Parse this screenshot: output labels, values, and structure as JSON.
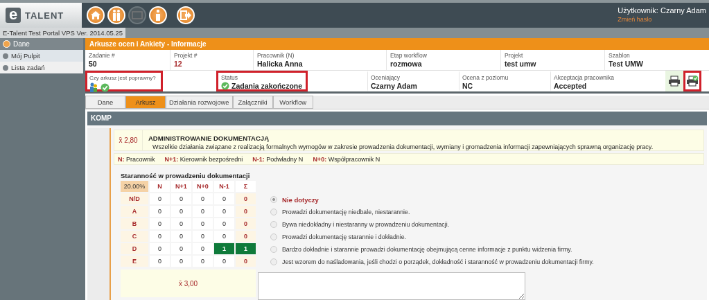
{
  "header": {
    "logo_mark": "e",
    "logo_text": "TALENT",
    "user": "Użytkownik: Czarny Adam",
    "change_password": "Zmień hasło",
    "toolbar": [
      {
        "kind": "home",
        "disabled": false
      },
      {
        "kind": "people",
        "disabled": false
      },
      {
        "kind": "blank",
        "disabled": true
      },
      {
        "kind": "info",
        "disabled": false
      },
      {
        "kind": "exit",
        "disabled": false
      }
    ]
  },
  "version": "E-Talent Test Portal VPS Ver. 2014.05.25",
  "sidebar": {
    "header": "Dane",
    "items": [
      {
        "label": "Mój Pulpit",
        "selected": true
      },
      {
        "label": "Lista zadań",
        "selected": false
      }
    ]
  },
  "page_title": "Arkusze ocen i Ankiety - Informacje",
  "info_row_1": [
    {
      "label": "Zadanie #",
      "value": "50",
      "kind": "text"
    },
    {
      "label": "Projekt #",
      "value": "12",
      "kind": "accent"
    },
    {
      "label": "Pracownik (N)",
      "value": "Halicka Anna",
      "kind": "text"
    },
    {
      "label": "Etap workflow",
      "value": "rozmowa",
      "kind": "text"
    },
    {
      "label": "Projekt",
      "value": "test umw",
      "kind": "text"
    },
    {
      "label": "Szablon",
      "value": "Test UMW",
      "kind": "text"
    }
  ],
  "info_row_2": [
    {
      "label": "Czy arkusz jest poprawny?",
      "kind": "validity",
      "highlighted": true
    },
    {
      "label": "Status",
      "value": "Zadania zakończone",
      "kind": "status",
      "highlighted": true
    },
    {
      "label": "Oceniający",
      "value": "Czarny Adam",
      "kind": "text",
      "highlighted": false
    },
    {
      "label": "Ocena z poziomu",
      "value": "NC",
      "kind": "text",
      "highlighted": false
    },
    {
      "label": "Akceptacja pracownika",
      "value": "Accepted",
      "kind": "text",
      "highlighted": false
    }
  ],
  "print_buttons": [
    {
      "kind": "print",
      "highlighted": false
    },
    {
      "kind": "print_checked",
      "highlighted": true
    }
  ],
  "tabs": [
    {
      "label": "Dane",
      "selected": false
    },
    {
      "label": "Arkusz",
      "selected": true
    },
    {
      "label": "Działania rozwojowe",
      "selected": false
    },
    {
      "label": "Załączniki",
      "selected": false
    },
    {
      "label": "Workflow",
      "selected": false
    }
  ],
  "section_title": "KOMP",
  "competency": {
    "score": "x̄ 2,80",
    "title": "ADMINISTROWANIE DOKUMENTACJĄ",
    "description": "Wszelkie działania związane z realizacją formalnych wymogów w zakresie prowadzenia dokumentacji, wymiany i gromadzenia informacji zapewniających sprawną organizację pracy."
  },
  "legend": [
    {
      "key": "N:",
      "label": "Pracownik"
    },
    {
      "key": "N+1:",
      "label": "Kierownik bezpośredni"
    },
    {
      "key": "N-1:",
      "label": "Podwładny N"
    },
    {
      "key": "N+0:",
      "label": "Współpracownik N"
    }
  ],
  "question": "Staranność w prowadzeniu dokumentacji",
  "matrix": {
    "weight": "20.00%",
    "columns": [
      "N",
      "N+1",
      "N+0",
      "N-1"
    ],
    "sum_header": "Σ",
    "rows": [
      {
        "label": "N/D",
        "cells": [
          {
            "text": "0",
            "selected": false
          },
          {
            "text": "0",
            "selected": false
          },
          {
            "text": "0",
            "selected": false
          },
          {
            "text": "0",
            "selected": false
          }
        ],
        "sum": {
          "text": "0",
          "selected": false
        }
      },
      {
        "label": "A",
        "cells": [
          {
            "text": "0",
            "selected": false
          },
          {
            "text": "0",
            "selected": false
          },
          {
            "text": "0",
            "selected": false
          },
          {
            "text": "0",
            "selected": false
          }
        ],
        "sum": {
          "text": "0",
          "selected": false
        }
      },
      {
        "label": "B",
        "cells": [
          {
            "text": "0",
            "selected": false
          },
          {
            "text": "0",
            "selected": false
          },
          {
            "text": "0",
            "selected": false
          },
          {
            "text": "0",
            "selected": false
          }
        ],
        "sum": {
          "text": "0",
          "selected": false
        }
      },
      {
        "label": "C",
        "cells": [
          {
            "text": "0",
            "selected": false
          },
          {
            "text": "0",
            "selected": false
          },
          {
            "text": "0",
            "selected": false
          },
          {
            "text": "0",
            "selected": false
          }
        ],
        "sum": {
          "text": "0",
          "selected": false
        }
      },
      {
        "label": "D",
        "cells": [
          {
            "text": "0",
            "selected": false
          },
          {
            "text": "0",
            "selected": false
          },
          {
            "text": "0",
            "selected": false
          },
          {
            "text": "1",
            "selected": true
          }
        ],
        "sum": {
          "text": "1",
          "selected": true
        }
      },
      {
        "label": "E",
        "cells": [
          {
            "text": "0",
            "selected": false
          },
          {
            "text": "0",
            "selected": false
          },
          {
            "text": "0",
            "selected": false
          },
          {
            "text": "0",
            "selected": false
          }
        ],
        "sum": {
          "text": "0",
          "selected": false
        }
      }
    ],
    "mean": "x̄ 3,00"
  },
  "options": [
    {
      "label": "Nie dotyczy",
      "selected": true
    },
    {
      "label": "Prowadzi dokumentację niedbale, niestarannie.",
      "selected": false
    },
    {
      "label": "Bywa niedokładny i niestaranny w prowadzeniu dokumentacji.",
      "selected": false
    },
    {
      "label": "Prowadzi dokumentację starannie i dokładnie.",
      "selected": false
    },
    {
      "label": "Bardzo dokładnie i starannie prowadzi dokumentację obejmującą cenne informacje z punktu widzenia firmy.",
      "selected": false
    },
    {
      "label": "Jest wzorem do naśladowania, jeśli chodzi o porządek, dokładność i staranność w prowadzeniu dokumentacji firmy.",
      "selected": false
    }
  ]
}
